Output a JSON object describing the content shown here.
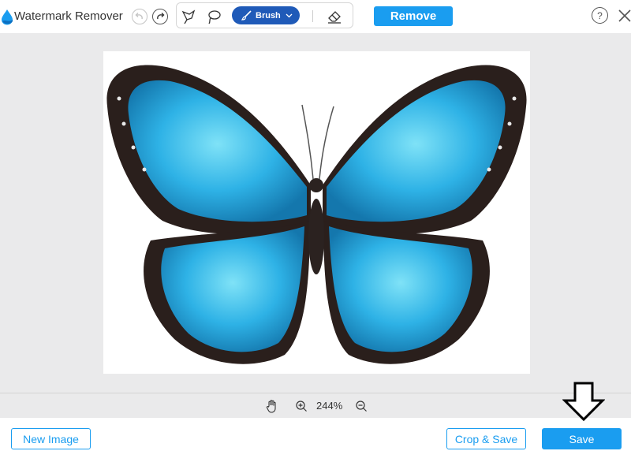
{
  "app": {
    "title": "Watermark Remover",
    "accent_color": "#1a9df0",
    "brush_color": "#1f5ab8"
  },
  "toolbar": {
    "undo_icon": "undo-icon",
    "redo_icon": "redo-icon",
    "tools": [
      {
        "name": "polygonal-lasso-icon"
      },
      {
        "name": "lasso-icon"
      },
      {
        "name": "brush-icon",
        "label": "Brush",
        "selected": true
      },
      {
        "name": "eraser-icon"
      }
    ],
    "brush_label": "Brush",
    "remove_label": "Remove",
    "help_label": "?",
    "close_icon": "close-icon"
  },
  "canvas": {
    "image_subject": "butterfly",
    "zoom_value": "244%"
  },
  "bottom": {
    "new_image_label": "New Image",
    "crop_save_label": "Crop & Save",
    "save_label": "Save"
  }
}
